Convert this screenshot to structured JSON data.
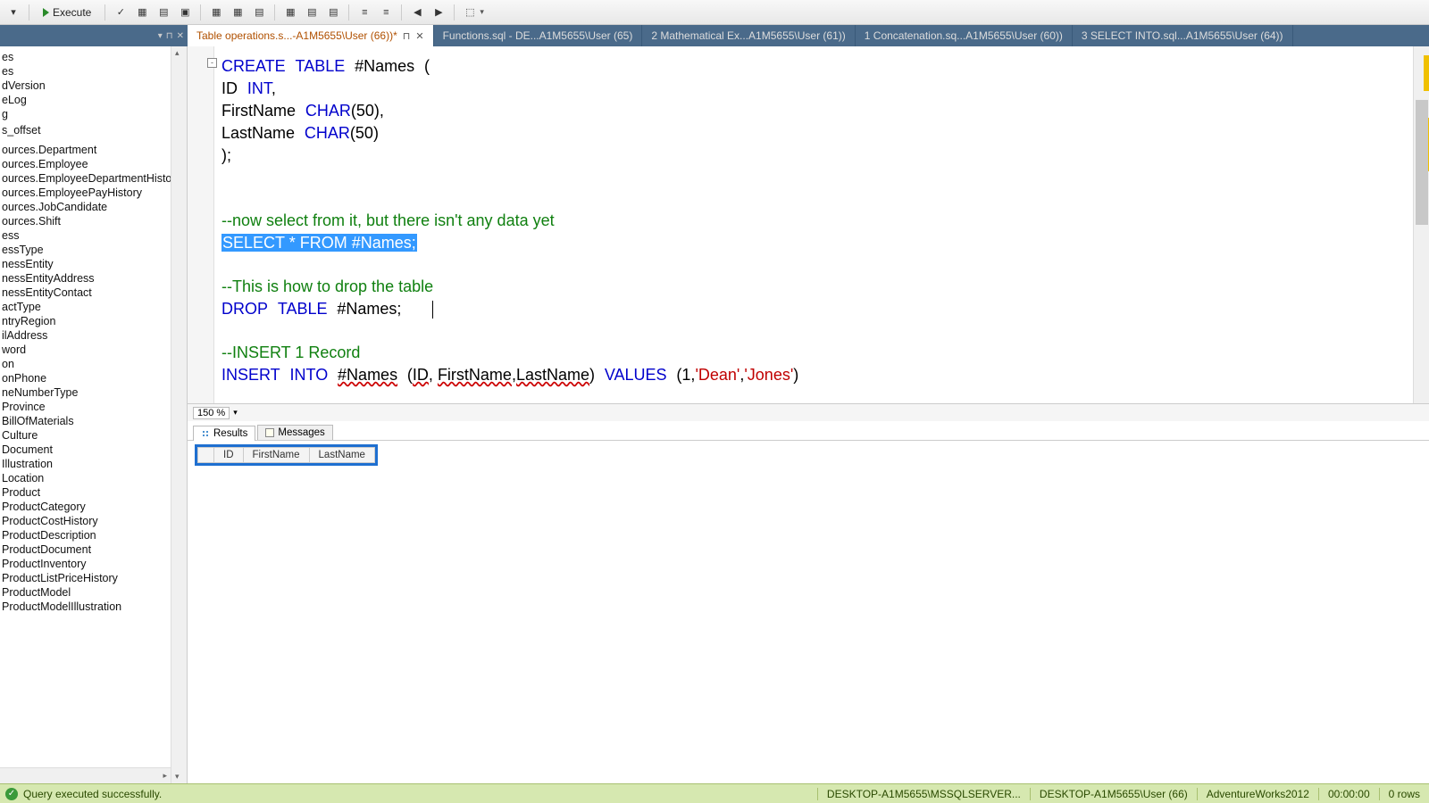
{
  "toolbar": {
    "execute_label": "Execute"
  },
  "tabs": [
    {
      "label": "Table operations.s...-A1M5655\\User (66))*",
      "active": true,
      "dirty": true
    },
    {
      "label": "Functions.sql - DE...A1M5655\\User (65)"
    },
    {
      "label": "2 Mathematical Ex...A1M5655\\User (61))"
    },
    {
      "label": "1 Concatenation.sq...A1M5655\\User (60))"
    },
    {
      "label": "3 SELECT INTO.sql...A1M5655\\User (64))"
    }
  ],
  "tree_items": [
    "es",
    "es",
    "dVersion",
    "eLog",
    "g",
    "",
    "s_offset",
    "",
    "",
    "",
    "ources.Department",
    "ources.Employee",
    "ources.EmployeeDepartmentHistory",
    "ources.EmployeePayHistory",
    "ources.JobCandidate",
    "ources.Shift",
    "ess",
    "essType",
    "nessEntity",
    "nessEntityAddress",
    "nessEntityContact",
    "actType",
    "ntryRegion",
    "ilAddress",
    "word",
    "on",
    "onPhone",
    "neNumberType",
    "Province",
    "BillOfMaterials",
    "Culture",
    "Document",
    "Illustration",
    "Location",
    "Product",
    "ProductCategory",
    "ProductCostHistory",
    "ProductDescription",
    "ProductDocument",
    "ProductInventory",
    "ProductListPriceHistory",
    "ProductModel",
    "ProductModelIllustration"
  ],
  "code": {
    "l1_create": "CREATE",
    "l1_table": "TABLE",
    "l1_name": "#Names",
    "l1_paren": "(",
    "l2_id": "ID",
    "l2_int": "INT",
    "l2_comma": ",",
    "l3_fn": "FirstName",
    "l3_char": "CHAR",
    "l3_p1": "(",
    "l3_50": "50",
    "l3_p2": ")",
    "l3_comma": ",",
    "l4_ln": "LastName",
    "l4_char": "CHAR",
    "l4_p1": "(",
    "l4_50": "50",
    "l4_p2": ")",
    "l5_close": ");",
    "c1": "--now select from it, but there isn't any data yet",
    "s_select": "SELECT",
    "s_star": "*",
    "s_from": "FROM",
    "s_names": "#Names",
    "s_semi": ";",
    "c2": "--This is how to drop the table",
    "d_drop": "DROP",
    "d_table": "TABLE",
    "d_names": "#Names",
    "d_semi": ";",
    "c3": "--INSERT 1 Record",
    "i_ins": "INSERT",
    "i_into": "INTO",
    "i_names": "#Names",
    "i_p1": "(",
    "i_id": "ID",
    "i_c1": ", ",
    "i_fn": "FirstName",
    "i_c2": ",",
    "i_ln": "LastName",
    "i_p2": ")",
    "i_vals": "VALUES",
    "i_p3": "(",
    "i_1": "1",
    "i_c3": ",",
    "i_dean": "'Dean'",
    "i_c4": ",",
    "i_jones": "'Jones'",
    "i_p4": ")"
  },
  "zoom": "150 %",
  "result_tabs": {
    "results": "Results",
    "messages": "Messages"
  },
  "grid_headers": [
    "ID",
    "FirstName",
    "LastName"
  ],
  "status": {
    "msg": "Query executed successfully.",
    "server": "DESKTOP-A1M5655\\MSSQLSERVER...",
    "user": "DESKTOP-A1M5655\\User (66)",
    "db": "AdventureWorks2012",
    "time": "00:00:00",
    "rows": "0 rows"
  }
}
